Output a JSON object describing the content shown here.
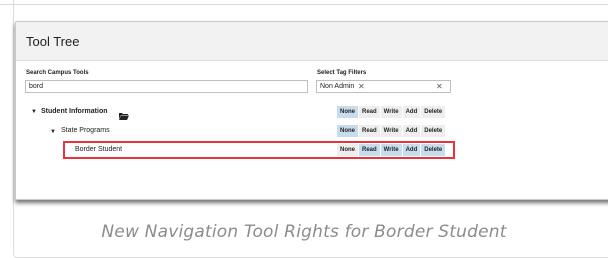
{
  "panel": {
    "title": "Tool Tree"
  },
  "search": {
    "label": "Search Campus Tools",
    "value": "bord"
  },
  "tags": {
    "label": "Select Tag Filters",
    "chip": "Non Admin",
    "remove_icon": "close-icon",
    "clear_icon": "close-icon"
  },
  "rights_labels": [
    "None",
    "Read",
    "Write",
    "Add",
    "Delete"
  ],
  "tree": [
    {
      "label": "Student Information",
      "icon": "folder-open-icon",
      "active": [
        "None"
      ]
    },
    {
      "label": "State Programs",
      "active": [
        "None"
      ]
    },
    {
      "label": "Border Student",
      "active": [
        "Read",
        "Write",
        "Add",
        "Delete"
      ]
    }
  ],
  "caption": "New Navigation Tool Rights for Border Student",
  "colors": {
    "highlight": "#e8323c",
    "active_button": "#c7dcee"
  }
}
